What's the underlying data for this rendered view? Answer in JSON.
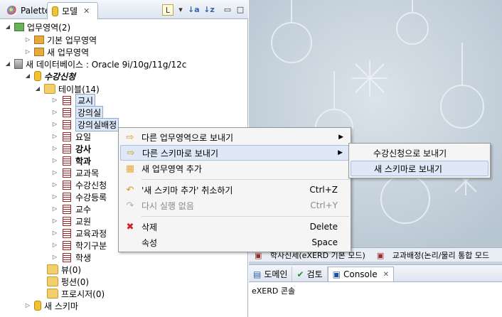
{
  "tabs": {
    "palette": "Palette",
    "model": "모델"
  },
  "tree": {
    "area_root": "업무영역(2)",
    "area_basic": "기본 업무영역",
    "area_new": "새 업무영역",
    "db_root": "새 데이터베이스 : Oracle 9i/10g/11g/12c",
    "schema": "수강신청",
    "tables_folder": "테이블(14)",
    "tables": [
      "교시",
      "강의실",
      "강의실배정",
      "요일",
      "강사",
      "학과",
      "교과목",
      "수강신청",
      "수강등록",
      "교수",
      "교원",
      "교육과정",
      "학기구분",
      "학생"
    ],
    "views": "뷰(0)",
    "functions": "펑션(0)",
    "procedures": "프로시저(0)",
    "new_schema": "새 스키마"
  },
  "menu": {
    "send_area": "다른 업무영역으로 보내기",
    "send_schema": "다른 스키마로 보내기",
    "add_area": "새 업무영역 추가",
    "undo": "'새 스키마 추가' 취소하기",
    "undo_acc": "Ctrl+Z",
    "redo": "다시 실행 없음",
    "redo_acc": "Ctrl+Y",
    "delete": "삭제",
    "delete_acc": "Delete",
    "props": "속성",
    "props_acc": "Space"
  },
  "submenu": {
    "item1": "수강신청으로 보내기",
    "item2": "새 스키마로 보내기"
  },
  "editor_tabs": {
    "tab1": "학사신세(eXERD 기본 모드)",
    "tab2": "교과배정(논리/물리 통합 모드"
  },
  "console": {
    "tab_domain": "도메인",
    "tab_review": "검토",
    "tab_console": "Console",
    "text": "eXERD 콘솔"
  }
}
